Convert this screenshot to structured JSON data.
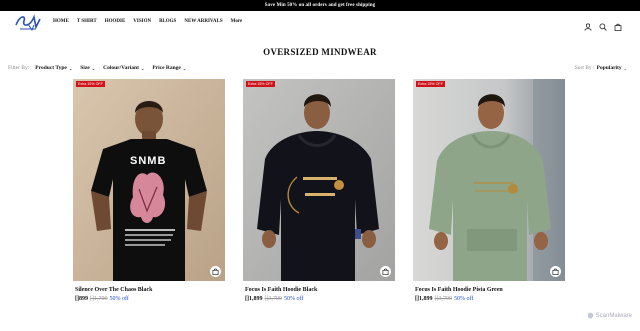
{
  "announcement": "Save Min 50% on all orders and get free shipping",
  "header": {
    "logo_text": "SNMB",
    "nav": [
      "HOME",
      "T SHIRT",
      "HOODIE",
      "VISION",
      "BLOGS",
      "NEW ARRIVALS",
      "More"
    ],
    "icons": [
      "user-icon",
      "search-icon",
      "cart-icon"
    ]
  },
  "page_title": "OVERSIZED MINDWEAR",
  "filters": {
    "label": "Filter By:",
    "items": [
      "Product Type",
      "Size",
      "Colour/Variant",
      "Price Range"
    ]
  },
  "sort": {
    "label": "Sort By :",
    "value": "Popularity"
  },
  "products": [
    {
      "badge": "Extra 15% OFF",
      "name": "Silence Over The Chaos Black",
      "price": "[]899",
      "was": "[]1,799",
      "off": "50% off"
    },
    {
      "badge": "Extra 15% OFF",
      "name": "Focus Is Faith Hoodie Black",
      "price": "[]1,899",
      "was": "[]3,799",
      "off": "50% off"
    },
    {
      "badge": "Extra 15% OFF",
      "name": "Focus Is Faith Hoodie Pista Green",
      "price": "[]1,899",
      "was": "[]3,799",
      "off": "50% off"
    }
  ],
  "watermark": "ScanMalware",
  "colors": {
    "badge": "#d0121b",
    "discount": "#1c4fd0",
    "announce_bg": "#000000"
  }
}
